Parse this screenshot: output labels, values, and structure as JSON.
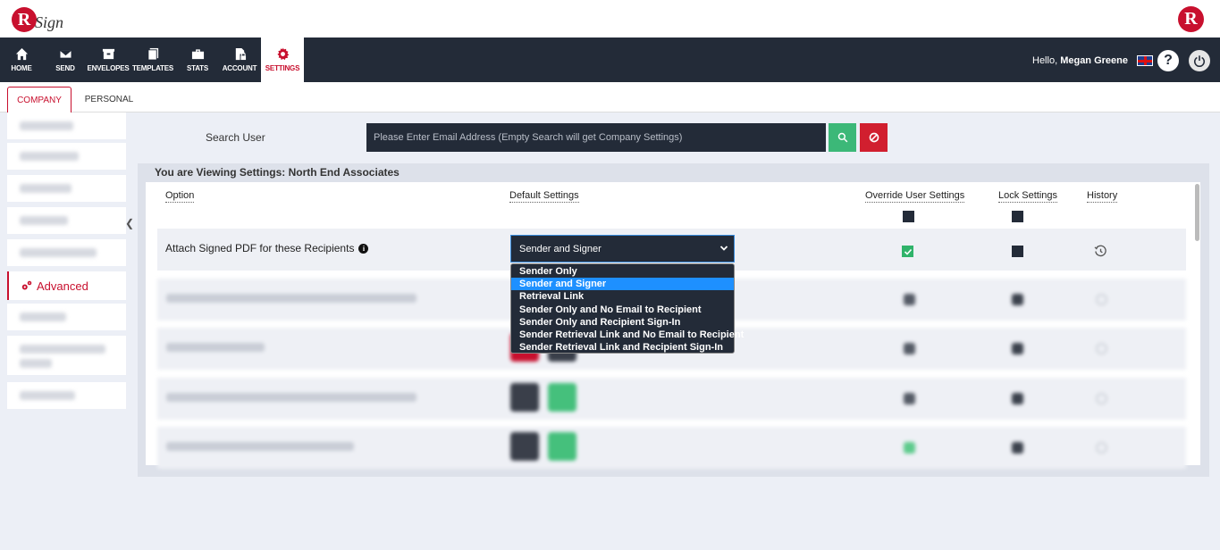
{
  "brand": {
    "logo_letter": "R",
    "logo_text": "Sign",
    "right_logo_letter": "R"
  },
  "nav": {
    "items": [
      {
        "label": "HOME",
        "icon": "home-icon"
      },
      {
        "label": "SEND",
        "icon": "envelope-icon"
      },
      {
        "label": "ENVELOPES",
        "icon": "inbox-icon"
      },
      {
        "label": "TEMPLATES",
        "icon": "documents-icon"
      },
      {
        "label": "STATS",
        "icon": "briefcase-icon"
      },
      {
        "label": "ACCOUNT",
        "icon": "file-lock-icon"
      },
      {
        "label": "SETTINGS",
        "icon": "gear-icon",
        "active": true
      }
    ],
    "greeting": "Hello,",
    "user_name": "Megan Greene",
    "help_label": "?"
  },
  "tabs": {
    "company": "COMPANY",
    "personal": "PERSONAL"
  },
  "sidebar": {
    "active_label": "Advanced"
  },
  "search": {
    "label": "Search User",
    "placeholder": "Please Enter Email Address (Empty Search will get Company Settings)"
  },
  "settings": {
    "viewing_title": "You are Viewing Settings: North End Associates",
    "columns": {
      "option": "Option",
      "default": "Default Settings",
      "override": "Override User Settings",
      "lock": "Lock Settings",
      "history": "History"
    },
    "row": {
      "label": "Attach Signed PDF for these Recipients",
      "selected_value": "Sender and Signer",
      "override_checked": true,
      "lock_checked": false
    },
    "dropdown_options": [
      "Sender Only",
      "Sender and Signer",
      "Retrieval Link",
      "Sender Only and No Email to Recipient",
      "Sender Only and Recipient Sign-In",
      "Sender Retrieval Link and No Email to Recipient",
      "Sender Retrieval Link and Recipient Sign-In"
    ],
    "highlighted_option_index": 1
  },
  "colors": {
    "brand_red": "#c8102e",
    "nav_dark": "#232b38",
    "accent_green": "#3cb878",
    "select_blue": "#1e90ff"
  }
}
